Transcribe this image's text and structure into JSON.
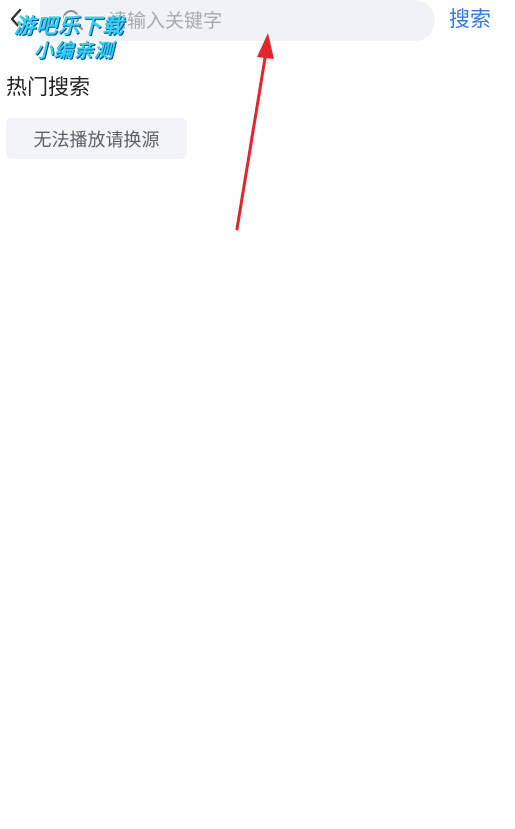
{
  "header": {
    "back_icon": "chevron-left-icon",
    "search": {
      "icon": "search-icon",
      "placeholder": "请输入关键字"
    },
    "search_button_label": "搜索"
  },
  "hot_search": {
    "title": "热门搜索",
    "tags": [
      {
        "label": "无法播放请换源"
      }
    ]
  },
  "watermark": {
    "line1": "游吧乐下载",
    "line2": "小编亲测"
  },
  "colors": {
    "accent": "#2f7bf5",
    "search_bg": "#f1f2f4",
    "tag_bg": "#f3f4f6",
    "annotation_arrow": "#e3262b",
    "watermark": "#2ad6f0"
  }
}
